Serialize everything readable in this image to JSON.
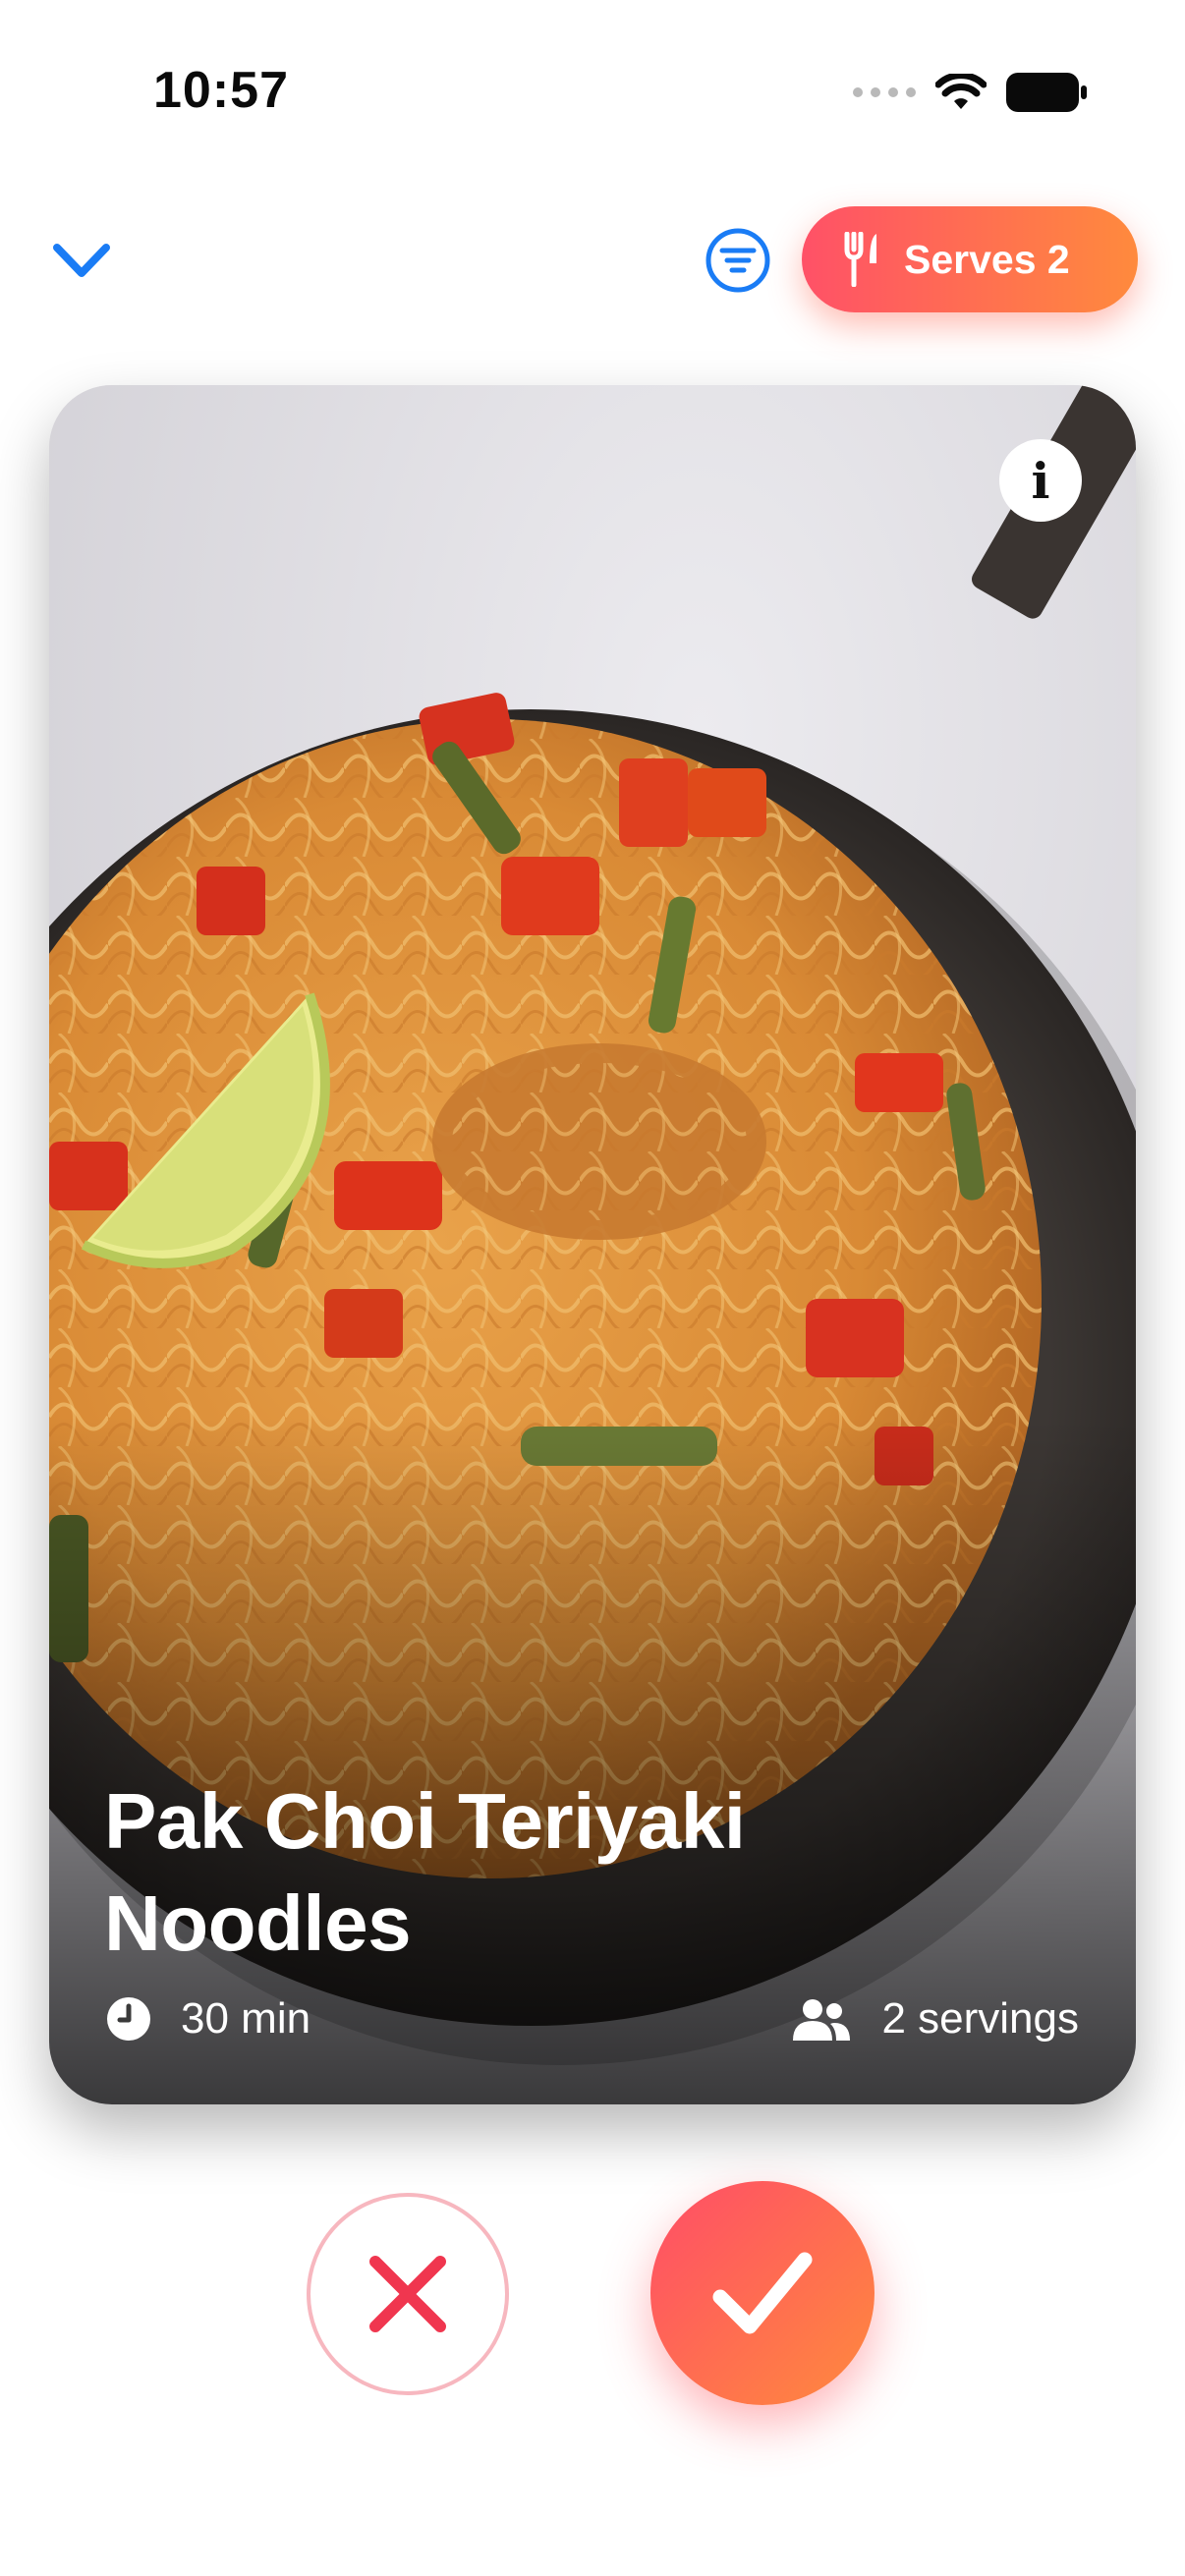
{
  "status_bar": {
    "time": "10:57",
    "icons": [
      "signal-dots",
      "wifi-icon",
      "battery-icon"
    ]
  },
  "top_bar": {
    "back_icon": "chevron-down-icon",
    "filter_icon": "filter-icon",
    "serves_label": "Serves 2",
    "serves_icon": "fork-knife-icon"
  },
  "recipe": {
    "title_line1": "Pak Choi Teriyaki",
    "title_line2": "Noodles",
    "time": "30 min",
    "servings": "2 servings",
    "time_icon": "clock-icon",
    "servings_icon": "people-icon",
    "info_label": "i"
  },
  "actions": {
    "reject_icon": "close-icon",
    "accept_icon": "check-icon"
  },
  "colors": {
    "accent_start": "#ff5167",
    "accent_end": "#ff8a3d",
    "link_blue": "#1a7cf5",
    "reject_red": "#f0364f"
  }
}
